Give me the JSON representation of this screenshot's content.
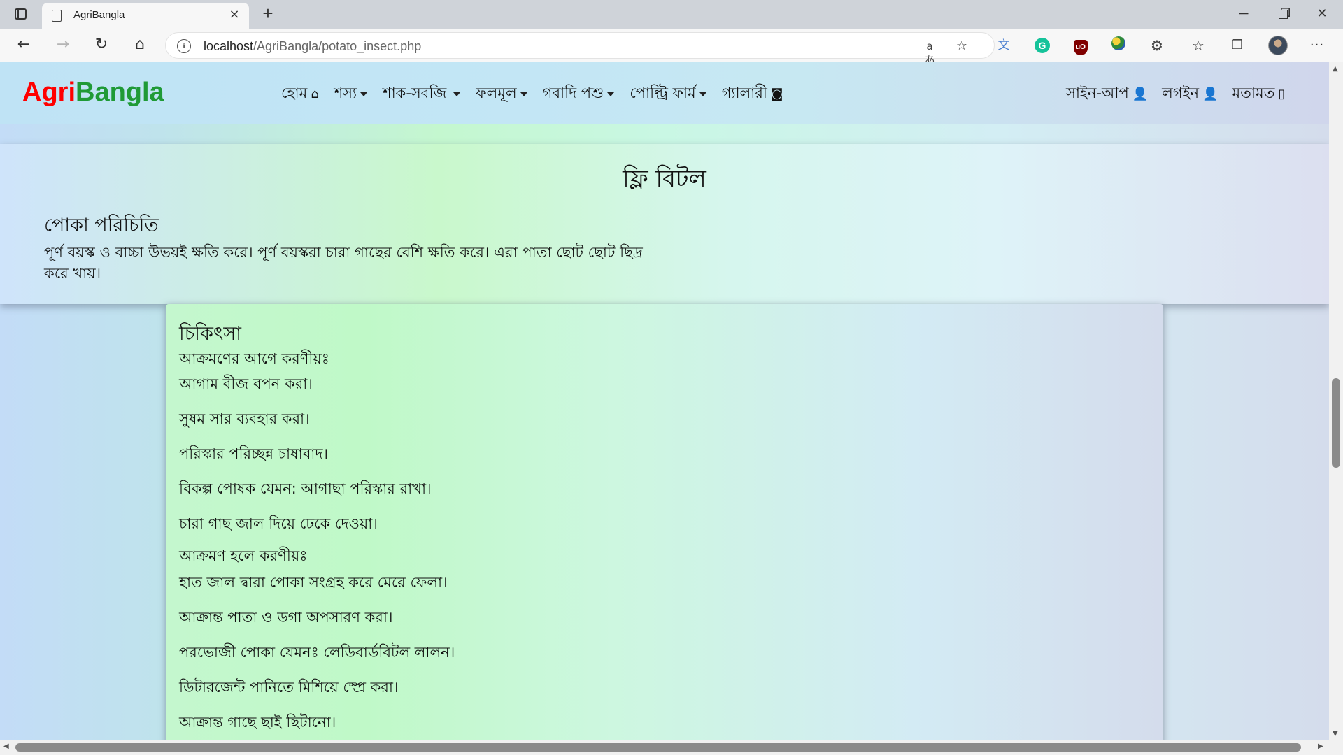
{
  "browser": {
    "tab_title": "AgriBangla",
    "tab_close": "×",
    "new_tab": "+",
    "url_host": "localhost",
    "url_path": "/AgriBangla/potato_insect.php",
    "info_icon": "i",
    "read_aloud": "aあ",
    "add_favorite_icon": "☆",
    "window_min": "─",
    "window_close": "✕",
    "more": "···"
  },
  "site": {
    "brand_agri": "Agri",
    "brand_bangla": "Bangla",
    "menu": [
      {
        "label": "হোম",
        "icon": "home-icon",
        "glyph": "🏠"
      },
      {
        "label": "শস্য",
        "dropdown": true
      },
      {
        "label": "শাক-সবজি",
        "dropdown": true
      },
      {
        "label": "ফলমূল",
        "dropdown": true
      },
      {
        "label": "গবাদি পশু",
        "dropdown": true
      },
      {
        "label": "পোল্ট্রি ফার্ম",
        "dropdown": true
      },
      {
        "label": "গ্যালারী",
        "icon": "camera-icon",
        "glyph": "📷"
      }
    ],
    "auth": [
      {
        "label": "সাইন-আপ",
        "icon": "user-plus-icon",
        "glyph": "👤+"
      },
      {
        "label": "লগইন",
        "icon": "user-icon",
        "glyph": "👤"
      },
      {
        "label": "মতামত",
        "icon": "mobile-icon",
        "glyph": "▯"
      }
    ],
    "brand_colors": {
      "agri": "#ff0000",
      "bangla": "#1f9a36"
    }
  },
  "pest": {
    "name": "ফ্লি বিটল",
    "intro_heading": "পোকা পরিচিতি",
    "intro_text": "পূর্ণ বয়স্ক ও বাচ্চা উভয়ই ক্ষতি করে। পূর্ণ বয়স্করা চারা গাছের বেশি ক্ষতি করে। এরা পাতা ছোট ছোট ছিদ্র করে খায়।"
  },
  "treatment": {
    "title": "চিকিৎসা",
    "before_heading": "আক্রমণের আগে করণীয়ঃ",
    "before_items": [
      "আগাম বীজ বপন করা।",
      "সুষম সার ব্যবহার করা।",
      "পরিস্কার পরিচ্ছন্ন চাষাবাদ।",
      "বিকল্প পোষক যেমন: আগাছা পরিস্কার রাখা।",
      "চারা গাছ জাল দিয়ে ঢেকে দেওয়া।"
    ],
    "after_heading": "আক্রমণ হলে করণীয়ঃ",
    "after_items": [
      "হাত জাল দ্বারা পোকা সংগ্রহ করে মেরে ফেলা।",
      "আক্রান্ত পাতা ও ডগা অপসারণ করা।",
      "পরভোজী পোকা যেমনঃ লেডিবার্ডবিটল লালন।",
      "ডিটারজেন্ট পানিতে মিশিয়ে স্প্রে করা।",
      "আক্রান্ত গাছে ছাই ছিটানো।"
    ]
  }
}
